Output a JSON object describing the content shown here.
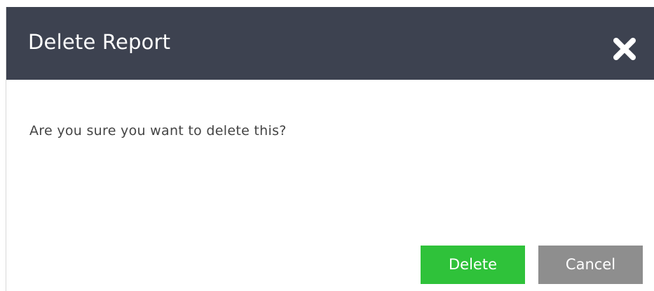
{
  "dialog": {
    "title": "Delete Report",
    "close_icon": "close-icon",
    "message": "Are you sure you want to delete this?",
    "delete_label": "Delete",
    "cancel_label": "Cancel"
  },
  "colors": {
    "titlebar": "#3d4250",
    "delete": "#2fc23a",
    "cancel": "#8e8e8e",
    "text": "#444444"
  }
}
